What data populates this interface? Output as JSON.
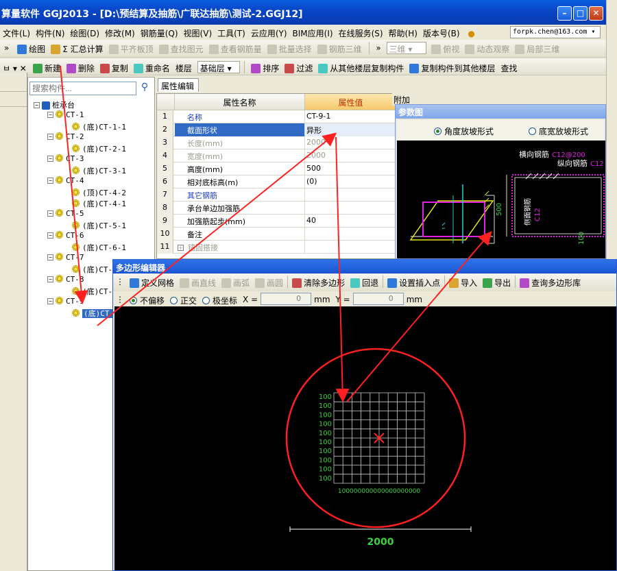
{
  "window": {
    "title": "算量软件 GGJ2013 - [D:\\预结算及抽筋\\广联达抽筋\\测试-2.GGJ12]",
    "min_glyph": "–",
    "max_glyph": "□",
    "close_glyph": "✕"
  },
  "menu": {
    "items": [
      "文件(L)",
      "构件(N)",
      "绘图(D)",
      "修改(M)",
      "钢筋量(Q)",
      "视图(V)",
      "工具(T)",
      "云应用(Y)",
      "BIM应用(I)",
      "在线服务(S)",
      "帮助(H)",
      "版本号(B)"
    ],
    "email": "forpk.chen@163.com"
  },
  "toolbar1": {
    "items": [
      {
        "label": "绘图",
        "enabled": true,
        "icon": "draw-icon"
      },
      {
        "label": "Σ 汇总计算",
        "enabled": true,
        "icon": "sum-icon"
      },
      {
        "label": "平齐板顶",
        "enabled": false,
        "icon": "align-icon"
      },
      {
        "label": "查找图元",
        "enabled": false,
        "icon": "find-icon"
      },
      {
        "label": "查看钢筋量",
        "enabled": false,
        "icon": "view-rebar-icon"
      },
      {
        "label": "批量选择",
        "enabled": false,
        "icon": "batch-select-icon"
      },
      {
        "label": "钢筋三维",
        "enabled": false,
        "icon": "rebar-3d-icon"
      }
    ],
    "view3d": "三维",
    "items2": [
      "俯视",
      "动态观察",
      "局部三维"
    ]
  },
  "toolbar2": {
    "items": [
      "新建",
      "删除",
      "复制",
      "重命名",
      "楼层"
    ],
    "floor": "基础层",
    "items2": [
      "排序",
      "过滤",
      "从其他楼层复制构件",
      "复制构件到其他楼层",
      "查找"
    ]
  },
  "nav": {
    "search_placeholder": "搜索构件...",
    "root": "桩承台",
    "nodes": [
      {
        "name": "CT-1",
        "children": [
          "(底)CT-1-1"
        ]
      },
      {
        "name": "CT-2",
        "children": [
          "(底)CT-2-1"
        ]
      },
      {
        "name": "CT-3",
        "children": [
          "(底)CT-3-1"
        ]
      },
      {
        "name": "CT-4",
        "children": [
          "(顶)CT-4-2",
          "(底)CT-4-1"
        ]
      },
      {
        "name": "CT-5",
        "children": [
          "(底)CT-5-1"
        ]
      },
      {
        "name": "CT-6",
        "children": [
          "(底)CT-6-1"
        ]
      },
      {
        "name": "CT-7",
        "children": [
          "(底)CT-"
        ]
      },
      {
        "name": "CT-8",
        "children": [
          "(底)CT-"
        ]
      },
      {
        "name": "CT-9",
        "children": [
          "(底)CT-"
        ]
      }
    ]
  },
  "props": {
    "tab": "属性编辑",
    "col_name": "属性名称",
    "col_value": "属性值",
    "rows": [
      {
        "n": "1",
        "name": "名称",
        "value": "CT-9-1",
        "style": "blue"
      },
      {
        "n": "2",
        "name": "截面形状",
        "value": "异形",
        "style": "selected"
      },
      {
        "n": "3",
        "name": "长度(mm)",
        "value": "2000",
        "style": "grey"
      },
      {
        "n": "4",
        "name": "宽度(mm)",
        "value": "2000",
        "style": "grey"
      },
      {
        "n": "5",
        "name": "高度(mm)",
        "value": "500",
        "style": ""
      },
      {
        "n": "6",
        "name": "相对底标高(m)",
        "value": "(0)",
        "style": ""
      },
      {
        "n": "7",
        "name": "其它钢筋",
        "value": "",
        "style": "blue"
      },
      {
        "n": "8",
        "name": "承台单边加强筋",
        "value": "",
        "style": ""
      },
      {
        "n": "9",
        "name": "加强筋起步(mm)",
        "value": "40",
        "style": ""
      },
      {
        "n": "10",
        "name": "备注",
        "value": "",
        "style": ""
      },
      {
        "n": "11",
        "name": "锚固搭接",
        "value": "",
        "style": "grey",
        "expander": "+"
      }
    ]
  },
  "param": {
    "attach": "附加",
    "title": "参数图",
    "opt1": "角度放坡形式",
    "opt2": "底宽放坡形式",
    "label_h": "横向钢筋",
    "label_h_spec": "C12@200",
    "label_v": "纵向钢筋",
    "label_v_spec": "C12",
    "label_side": "侧面钢筋",
    "label_side_spec": "C12",
    "dim": "500",
    "dim2": "100"
  },
  "poly": {
    "title": "多边形编辑器",
    "tools": [
      {
        "label": "定义网格",
        "enabled": true,
        "icon": "grid-icon"
      },
      {
        "label": "画直线",
        "enabled": false,
        "icon": "line-icon"
      },
      {
        "label": "画弧",
        "enabled": false,
        "icon": "arc-icon"
      },
      {
        "label": "画圆",
        "enabled": false,
        "icon": "circle-icon"
      },
      {
        "label": "清除多边形",
        "enabled": true,
        "icon": "clear-icon"
      },
      {
        "label": "回退",
        "enabled": true,
        "icon": "undo-icon"
      },
      {
        "label": "设置插入点",
        "enabled": true,
        "icon": "insert-point-icon"
      },
      {
        "label": "导入",
        "enabled": true,
        "icon": "import-icon"
      },
      {
        "label": "导出",
        "enabled": true,
        "icon": "export-icon"
      },
      {
        "label": "查询多边形库",
        "enabled": true,
        "icon": "query-icon"
      }
    ],
    "modes": [
      "不偏移",
      "正交",
      "极坐标"
    ],
    "x_label": "X =",
    "x_value": "0",
    "y_label": "Y =",
    "y_value": "0",
    "unit": "mm",
    "grid_labels": [
      "100",
      "100",
      "100",
      "100",
      "100",
      "100",
      "100",
      "100",
      "100",
      "100"
    ],
    "x_axis": "100000000000000000000",
    "total": "2000",
    "grid_color": "#cfcfcf",
    "label_color": "#3cd23c",
    "mark_color": "#ff2020"
  }
}
